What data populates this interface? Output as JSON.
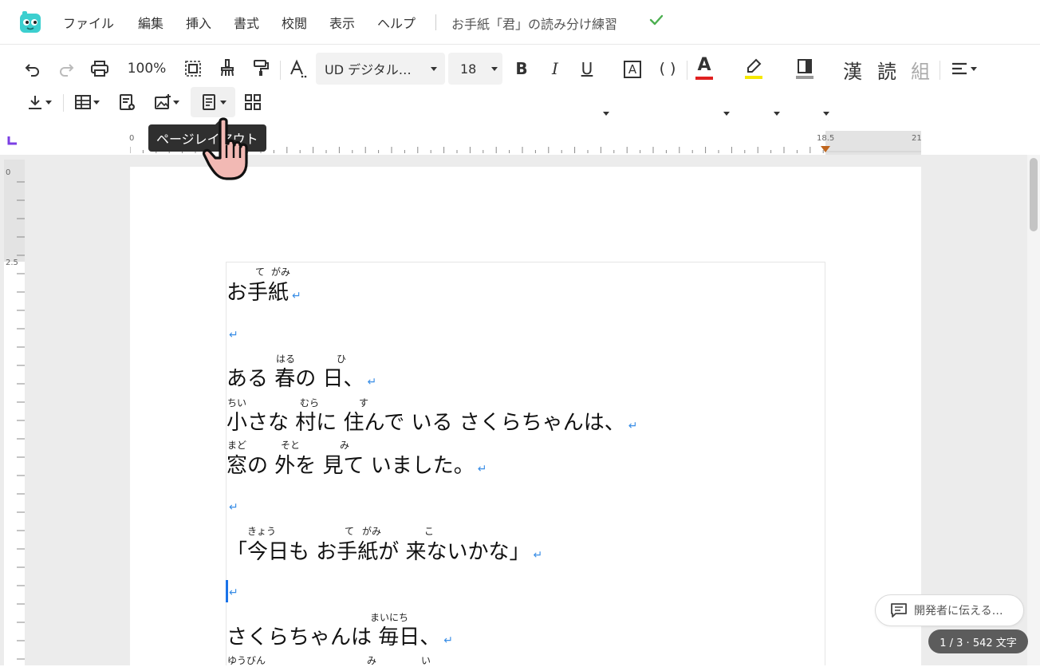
{
  "menu": {
    "items": [
      "ファイル",
      "編集",
      "挿入",
      "書式",
      "校閲",
      "表示",
      "ヘルプ"
    ],
    "doc_title": "お手紙「君」の読み分け練習"
  },
  "toolbar": {
    "zoom": "100%",
    "font_name": "UD デジタル…",
    "font_size": "18",
    "bold_glyph": "B",
    "italic_glyph": "I",
    "underline_glyph": "U",
    "boxed_glyph": "A",
    "paren_glyph": "( )",
    "font_color_glyph": "A",
    "kanji_btn": "漢",
    "reading_btn": "読",
    "kumi_btn": "組"
  },
  "colors": {
    "accent_purple": "#7b3fe4",
    "font_color": "#e02020",
    "highlight": "#f5e800",
    "saved_green": "#4caf50",
    "para_mark": "#3a8ee6"
  },
  "ruler": {
    "h_labels": [
      "0",
      "18.5",
      "21"
    ],
    "v_labels": [
      "0",
      "2.5"
    ]
  },
  "tooltip": "ページレイアウト",
  "document": {
    "para_mark": "↵",
    "title_line": "お手紙",
    "title_ruby_te": "て",
    "title_ruby_gami": "がみ",
    "line1": "ある 春の 日、",
    "line1_ruby_haru": "はる",
    "line1_ruby_hi": "ひ",
    "line2": "小さな 村に 住んで いる さくらちゃんは、",
    "line2_ruby_chii": "ちい",
    "line2_ruby_mura": "むら",
    "line2_ruby_su": "す",
    "line3": "窓の 外を 見て いました。",
    "line3_ruby_mado": "まど",
    "line3_ruby_soto": "そと",
    "line3_ruby_mi": "み",
    "line4": "「今日も お手紙が 来ないかな」",
    "line4_ruby_kyou": "きょう",
    "line4_ruby_te": "て",
    "line4_ruby_gami": "がみ",
    "line4_ruby_ko": "こ",
    "line5": "さくらちゃんは 毎日、",
    "line5_ruby_mainichi": "まいにち",
    "next_ruby_yuubin": "ゆうびん",
    "next_ruby_mi": "み",
    "next_ruby_i": "い"
  },
  "feedback_label": "開発者に伝える…",
  "char_count": "1 / 3 · 542 文字"
}
